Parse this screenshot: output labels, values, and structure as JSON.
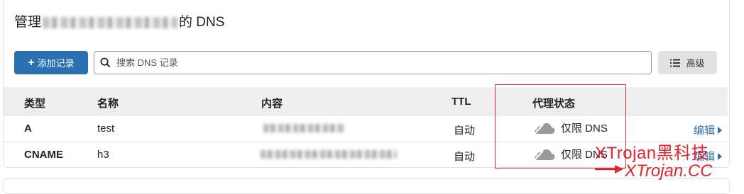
{
  "page": {
    "title_prefix": "管理",
    "title_suffix": "的 DNS"
  },
  "toolbar": {
    "add_label": "添加记录",
    "search_placeholder": "搜索 DNS 记录",
    "advanced_label": "高级"
  },
  "table": {
    "headers": {
      "type": "类型",
      "name": "名称",
      "content": "内容",
      "ttl": "TTL",
      "proxy": "代理状态"
    },
    "rows": [
      {
        "type": "A",
        "name": "test",
        "ttl": "自动",
        "proxy": "仅限 DNS",
        "edit": "编辑"
      },
      {
        "type": "CNAME",
        "name": "h3",
        "ttl": "自动",
        "proxy": "仅限 DNS",
        "edit": "编辑"
      }
    ]
  },
  "watermark": {
    "line1": "XTrojan黑科技",
    "line2": "XTrojan.CC"
  },
  "colors": {
    "primary": "#2a6fb0",
    "annotation_red": "#e0262e",
    "header_bg": "#eeeeee"
  }
}
